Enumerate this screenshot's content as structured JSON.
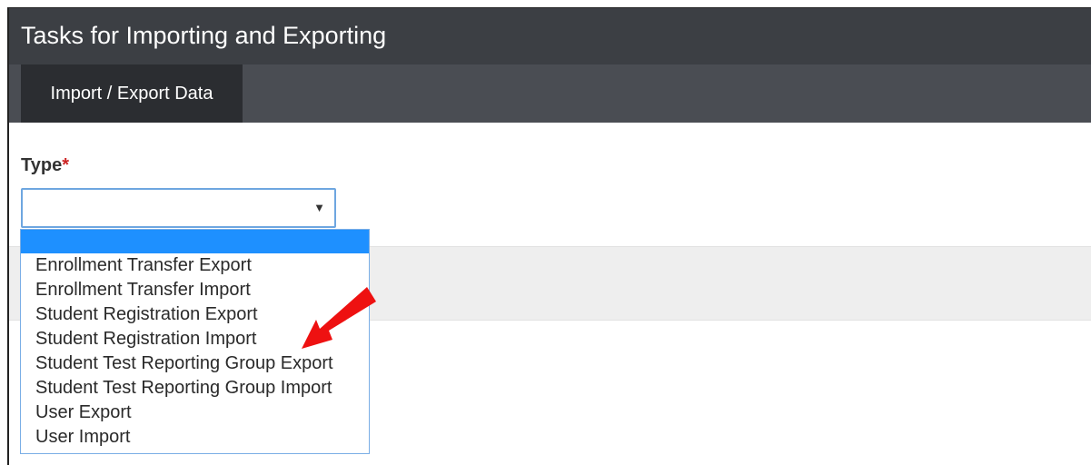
{
  "header": {
    "title": "Tasks for Importing and Exporting"
  },
  "tabs": [
    {
      "label": "Import / Export Data"
    }
  ],
  "form": {
    "type_label": "Type",
    "required_marker": "*",
    "selected_value": ""
  },
  "dropdown": {
    "options": [
      "Enrollment Transfer Export",
      "Enrollment Transfer Import",
      "Student Registration Export",
      "Student Registration Import",
      "Student Test Reporting Group Export",
      "Student Test Reporting Group Import",
      "User Export",
      "User Import"
    ]
  },
  "annotation": {
    "arrow_color": "#ee1111",
    "points_to": "Student Registration Import"
  },
  "colors": {
    "title_bar": "#3c3f44",
    "tab_bar": "#4a4d53",
    "active_tab": "#2b2d31",
    "highlight": "#1e90ff",
    "focus_border": "#6ea6e0"
  },
  "icons": {
    "select_arrow": "caret-down-icon"
  }
}
